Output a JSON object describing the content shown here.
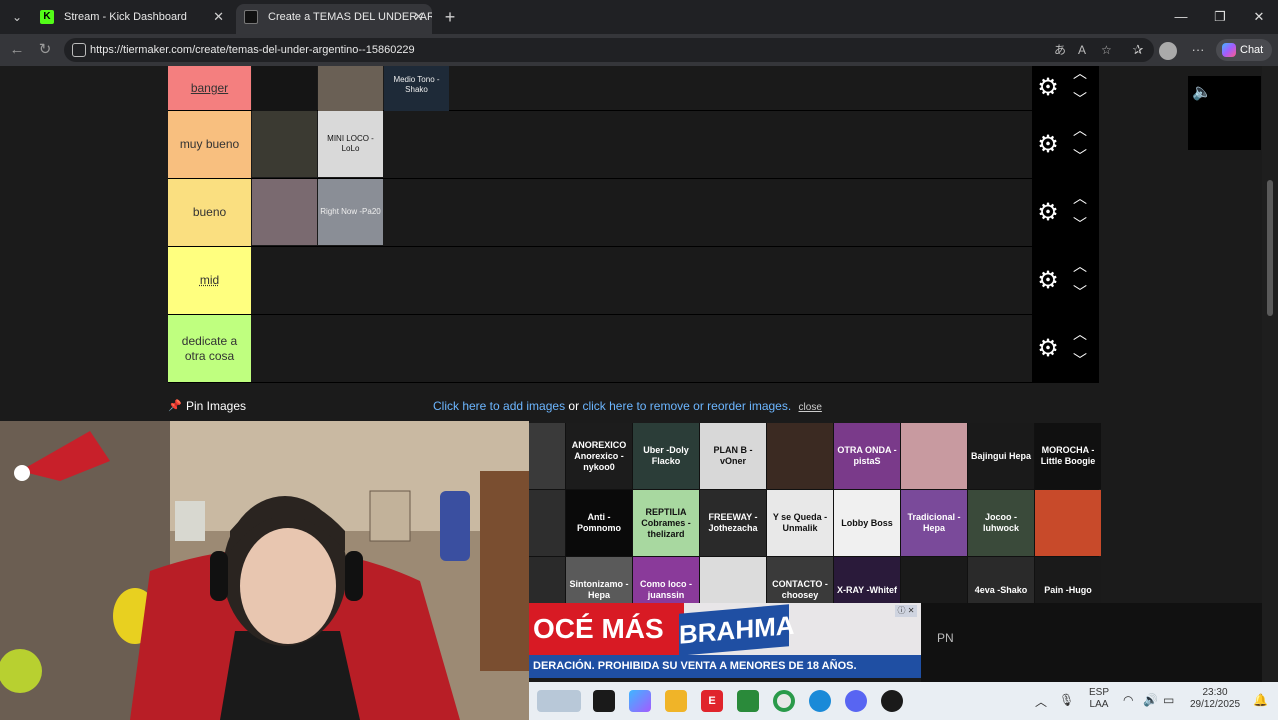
{
  "browser": {
    "tabs": [
      {
        "title": "Stream - Kick Dashboard",
        "icon": "kick-logo",
        "active": false
      },
      {
        "title": "Create a TEMAS DEL UNDER ARG",
        "icon": "tiermaker-logo",
        "active": true
      }
    ],
    "url": "https://tiermaker.com/create/temas-del-under-argentino--15860229",
    "chat_label": "Chat"
  },
  "tiers": [
    {
      "label": "banger",
      "color": "#f47f7f"
    },
    {
      "label": "muy bueno",
      "color": "#f8bf7f"
    },
    {
      "label": "bueno",
      "color": "#fadf80"
    },
    {
      "label": "mid",
      "color": "#ffff7f"
    },
    {
      "label": "dedicate a otra cosa",
      "color": "#bfff7f"
    }
  ],
  "tier_items": {
    "banger": [
      "",
      "",
      "Medio Tono -Shako"
    ],
    "muy bueno": [
      "",
      "MINI LOCO -LoLo"
    ],
    "bueno": [
      "",
      "Right Now -Pa20"
    ]
  },
  "pin_label": "Pin Images",
  "actions": {
    "add_link": "Click here to add images",
    "or": "or",
    "remove_link": "click here to remove or reorder images.",
    "close": "close"
  },
  "pool_items": [
    {
      "text": "",
      "bg": "#3a3a3a"
    },
    {
      "text": "ANOREXICO Anorexico -nykoo0",
      "bg": "#1c1c1c"
    },
    {
      "text": "Uber -Doly Flacko",
      "bg": "#2b3d38"
    },
    {
      "text": "PLAN B -vOner",
      "bg": "#d8d8d8"
    },
    {
      "text": "",
      "bg": "#3b2a22"
    },
    {
      "text": "OTRA ONDA -pistaS",
      "bg": "#7a3a8a"
    },
    {
      "text": "",
      "bg": "#c89aa0"
    },
    {
      "text": "Bajingui Hepa",
      "bg": "#1a1a1a"
    },
    {
      "text": "MOROCHA -Little Boogie",
      "bg": "#101010"
    },
    {
      "text": "",
      "bg": "#2e2e2e"
    },
    {
      "text": "Anti -Pomnomo",
      "bg": "#0a0a0a"
    },
    {
      "text": "REPTILIA Cobrames -thelizard",
      "bg": "#a8d8a0"
    },
    {
      "text": "FREEWAY -Jothezacha",
      "bg": "#2a2a2a"
    },
    {
      "text": "Y se Queda -Unmalik",
      "bg": "#e8e8e8"
    },
    {
      "text": "Lobby Boss",
      "bg": "#f0f0f0"
    },
    {
      "text": "Tradicional -Hepa",
      "bg": "#7a4a9a"
    },
    {
      "text": "Jocoo -luhwock",
      "bg": "#3a4a3a"
    },
    {
      "text": "",
      "bg": "#c84a2a"
    },
    {
      "text": "",
      "bg": "#2a2a2a"
    },
    {
      "text": "Sintonizamo -Hepa",
      "bg": "#5a5a5a"
    },
    {
      "text": "Como loco -juanssin",
      "bg": "#8a3a9a"
    },
    {
      "text": "",
      "bg": "#dcdcdc"
    },
    {
      "text": "CONTACTO -choosey",
      "bg": "#3a3a3a"
    },
    {
      "text": "X-RAY -Whitef",
      "bg": "#2a1a3a"
    },
    {
      "text": "",
      "bg": "#1a1a1a"
    },
    {
      "text": "4eva -Shako",
      "bg": "#2a2a2a"
    },
    {
      "text": "Pain -Hugo",
      "bg": "#1a1a1a"
    }
  ],
  "ad": {
    "headline": "OCÉ MÁS",
    "brand": "BRAHMA",
    "disclaimer": "DERACIÓN. PROHIBIDA SU VENTA A MENORES DE 18 AÑOS.",
    "right_text": "PN"
  },
  "taskbar": {
    "lang": "ESP",
    "lang2": "LAA",
    "time": "23:30",
    "date": "29/12/2025"
  }
}
